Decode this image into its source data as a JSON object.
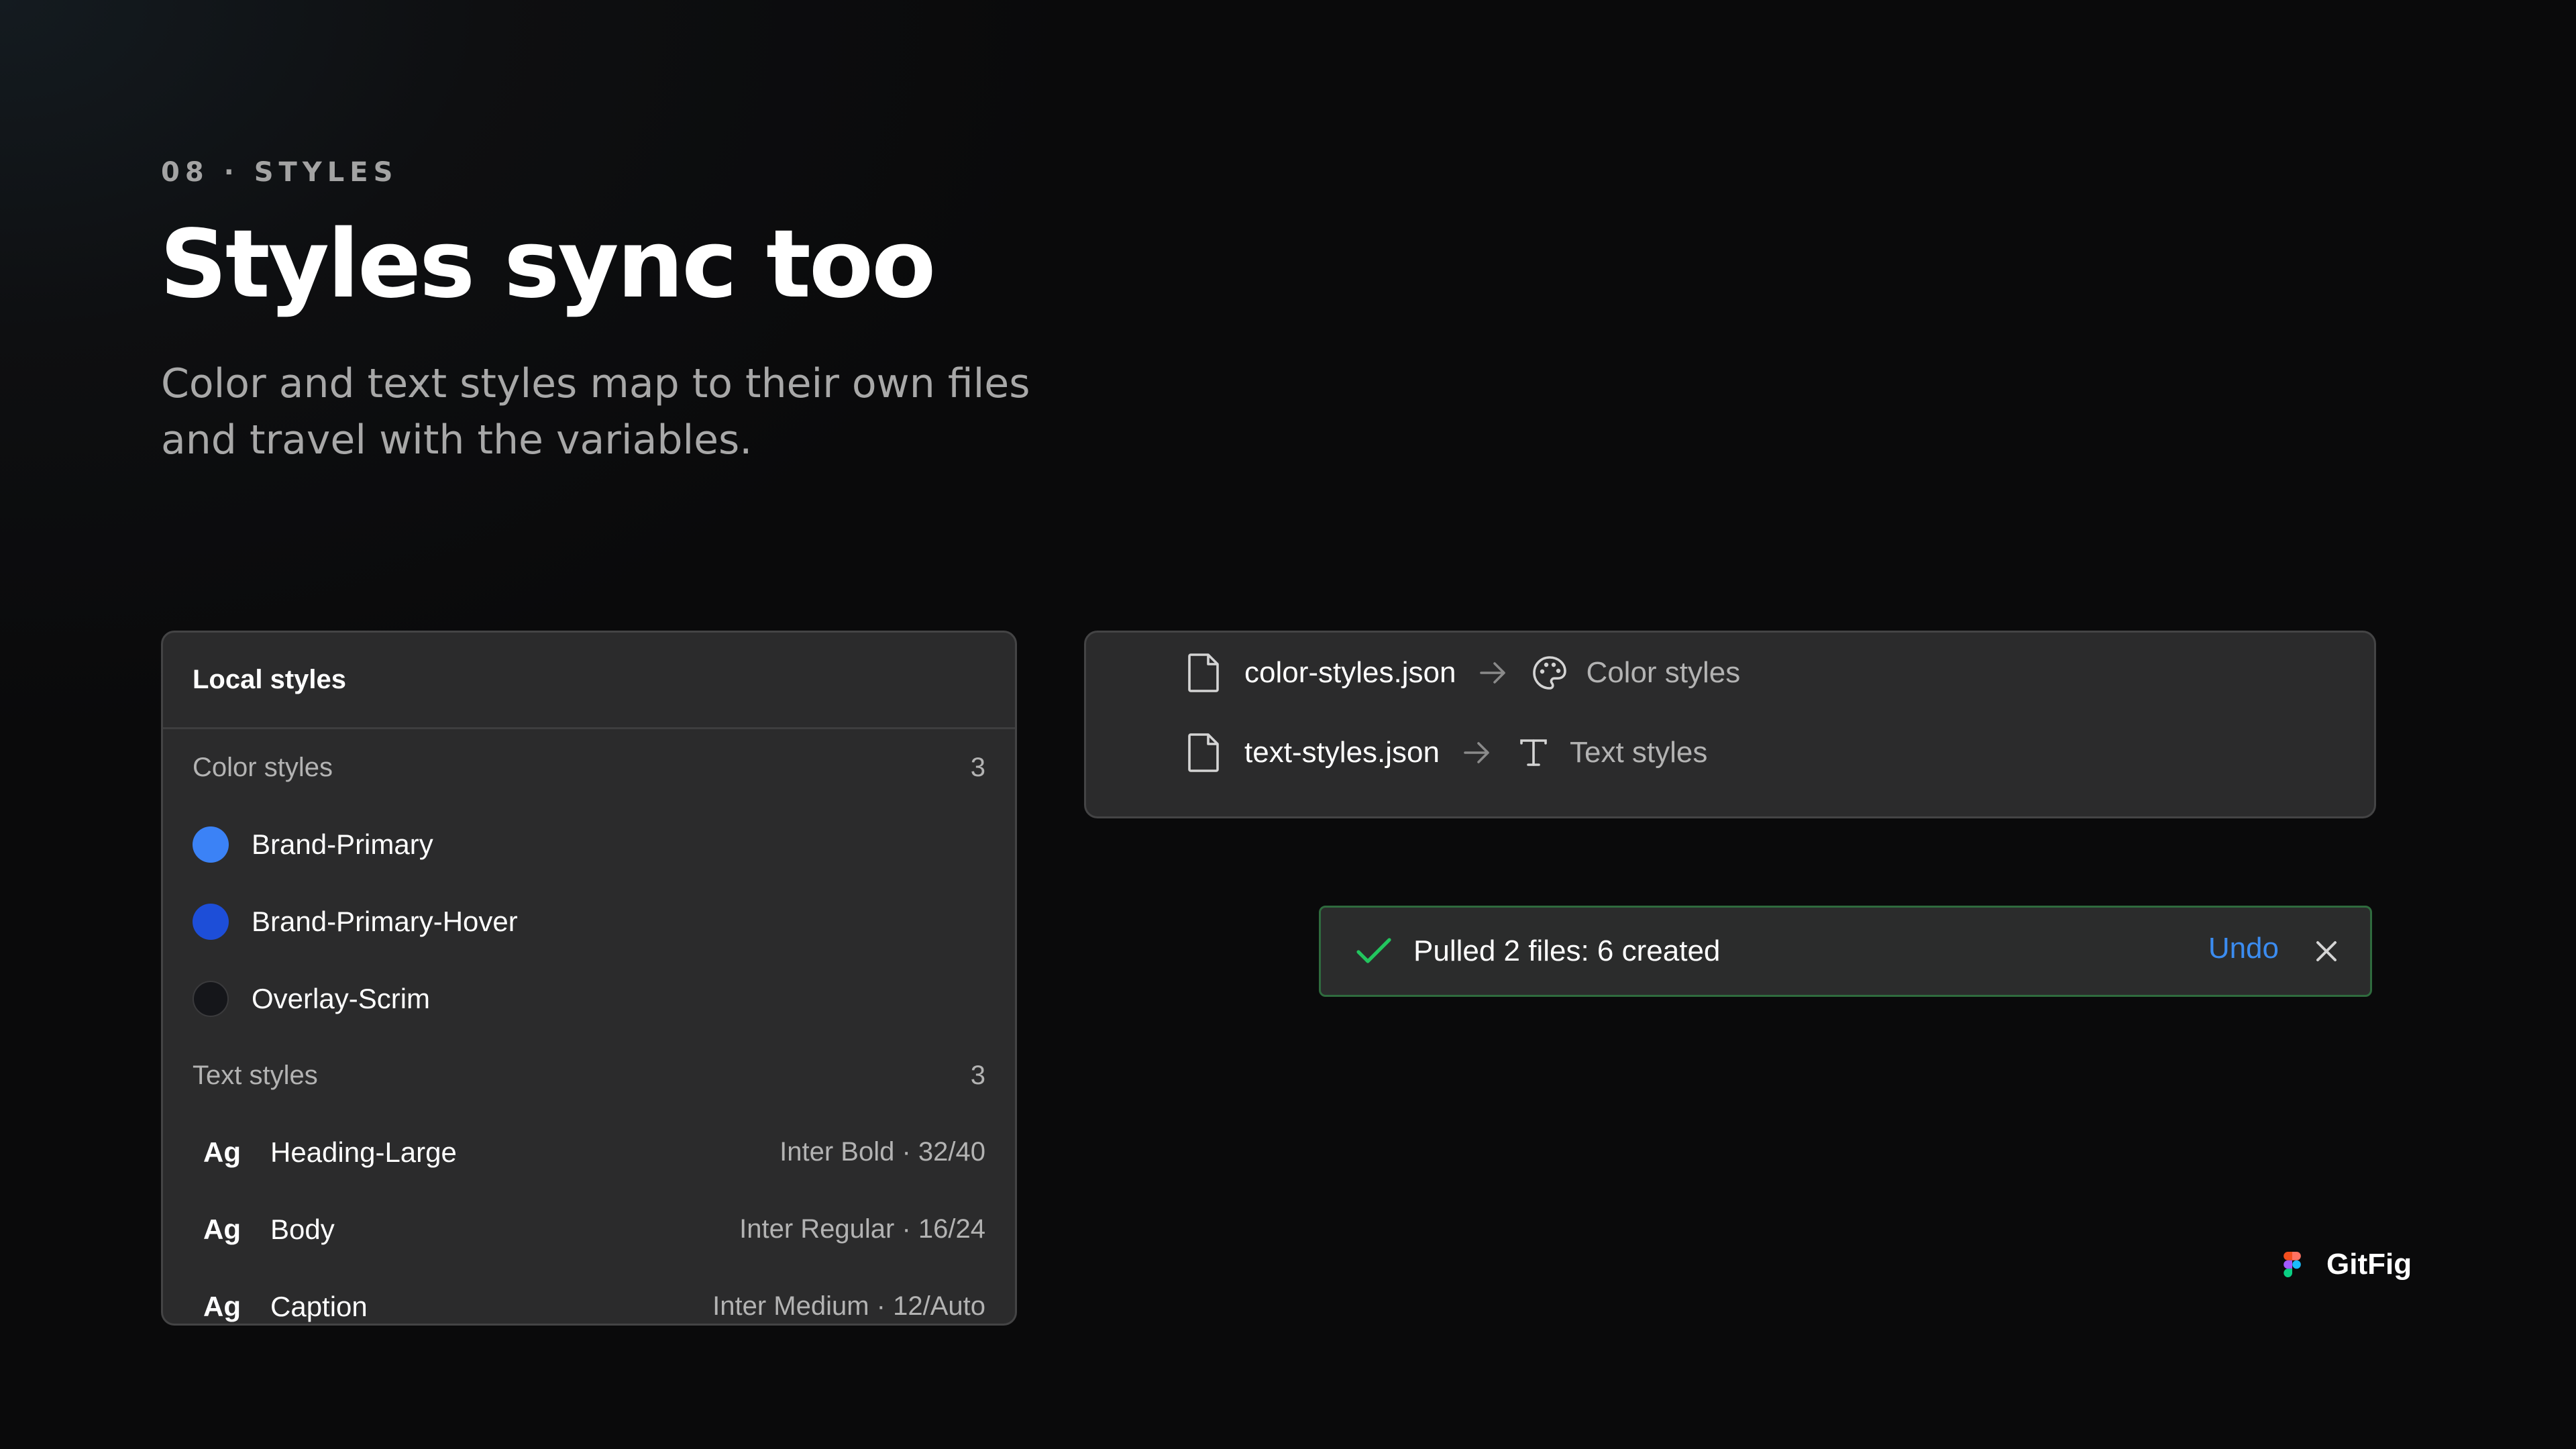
{
  "header": {
    "eyebrow": "08 · STYLES",
    "title": "Styles sync too",
    "subtitle": "Color and text styles map to their own files and travel with the variables."
  },
  "local_styles": {
    "title": "Local styles",
    "color_section": {
      "label": "Color styles",
      "count": "3",
      "items": [
        {
          "name": "Brand-Primary",
          "color": "#3b82f6"
        },
        {
          "name": "Brand-Primary-Hover",
          "color": "#1d4ed8"
        },
        {
          "name": "Overlay-Scrim",
          "color": "#15161a"
        }
      ]
    },
    "text_section": {
      "label": "Text styles",
      "count": "3",
      "items": [
        {
          "sample": "Ag",
          "name": "Heading-Large",
          "spec": "Inter Bold · 32/40"
        },
        {
          "sample": "Ag",
          "name": "Body",
          "spec": "Inter Regular · 16/24"
        },
        {
          "sample": "Ag",
          "name": "Caption",
          "spec": "Inter Medium · 12/Auto"
        }
      ]
    }
  },
  "mapping": {
    "rows": [
      {
        "file": "color-styles.json",
        "target": "Color styles",
        "target_icon": "palette-icon",
        "file_icon": "file-icon",
        "arrow_icon": "arrow-right-icon"
      },
      {
        "file": "text-styles.json",
        "target": "Text styles",
        "target_icon": "text-type-icon",
        "file_icon": "file-icon",
        "arrow_icon": "arrow-right-icon"
      }
    ]
  },
  "toast": {
    "message": "Pulled 2 files: 6 created",
    "undo_label": "Undo",
    "success_color": "#22c55e",
    "link_color": "#3b8cf0",
    "icons": [
      "check-icon",
      "close-icon"
    ]
  },
  "brand": {
    "name": "GitFig",
    "logo_icon": "figma-logo-icon"
  }
}
